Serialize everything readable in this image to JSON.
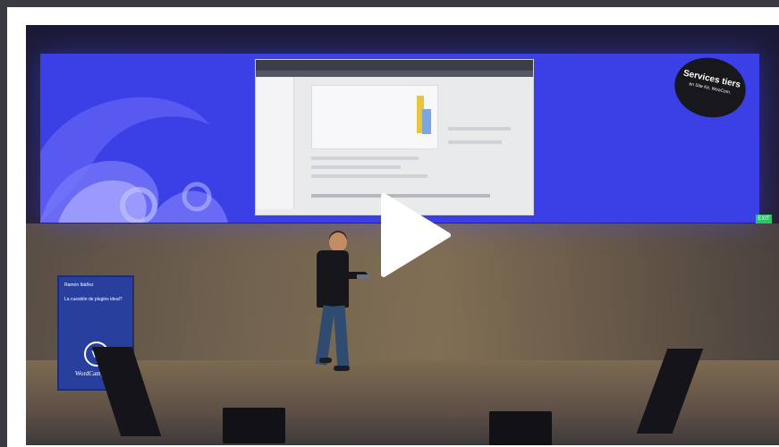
{
  "video": {
    "slide": {
      "badge_title": "Services tiers",
      "badge_subtitle": "en Site Kit, WooCom."
    },
    "side_panel": {
      "speaker_name": "Ramón Ibáñez",
      "talk_title": "La cuestión de plugins ideal?",
      "logo_letter": "W",
      "brand": "WordCamp"
    },
    "exit_sign": "EXIT"
  },
  "colors": {
    "screen_blue": "#3b3fe6",
    "panel_blue": "#283f9e",
    "play_icon": "#ffffff"
  },
  "icons": {
    "play": "play-triangle",
    "logo": "wordpress-logo"
  }
}
